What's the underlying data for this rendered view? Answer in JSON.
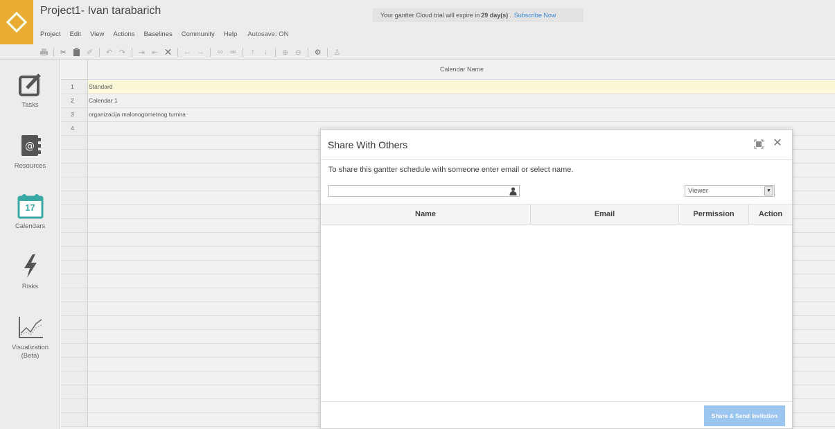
{
  "header": {
    "project_title": "Project1- Ivan tarabarich",
    "trial_prefix": "Your gantter Cloud trial will expire in",
    "trial_days": "29 day(s)",
    "trial_suffix": ".",
    "subscribe_label": "Subscribe Now",
    "brand_color": "#e8ae34"
  },
  "menu": {
    "items": [
      "Project",
      "Edit",
      "View",
      "Actions",
      "Baselines",
      "Community",
      "Help"
    ],
    "autosave": "Autosave: ON"
  },
  "toolbar": {
    "icons": [
      "print-icon",
      "cut-icon",
      "paste-icon",
      "format-painter-icon",
      "undo-icon",
      "redo-icon",
      "indent-icon",
      "outdent-icon",
      "delete-icon",
      "move-left-icon",
      "move-right-icon",
      "link-icon",
      "unlink-icon",
      "move-up-icon",
      "move-down-icon",
      "zoom-in-icon",
      "zoom-out-icon",
      "settings-icon",
      "assign-resource-icon"
    ]
  },
  "sidebar": {
    "items": [
      {
        "label": "Tasks",
        "icon": "tasks-icon"
      },
      {
        "label": "Resources",
        "icon": "resources-icon"
      },
      {
        "label": "Calendars",
        "icon": "calendar-icon",
        "day": "17"
      },
      {
        "label": "Risks",
        "icon": "risks-icon"
      },
      {
        "label": "Visualization",
        "label2": "(Beta)",
        "icon": "visualization-icon"
      }
    ]
  },
  "grid": {
    "column_header": "Calendar Name",
    "rows": [
      {
        "num": "1",
        "name": "Standard"
      },
      {
        "num": "2",
        "name": "Calendar 1"
      },
      {
        "num": "3",
        "name": "organizacija  malonogometnog turnira"
      },
      {
        "num": "4",
        "name": ""
      }
    ]
  },
  "modal": {
    "title": "Share With Others",
    "hint": "To share this gantter schedule with someone enter email or select name.",
    "email_value": "",
    "permission_value": "Viewer",
    "columns": {
      "name": "Name",
      "email": "Email",
      "permission": "Permission",
      "action": "Action"
    },
    "send_label": "Share & Send Invitation"
  }
}
